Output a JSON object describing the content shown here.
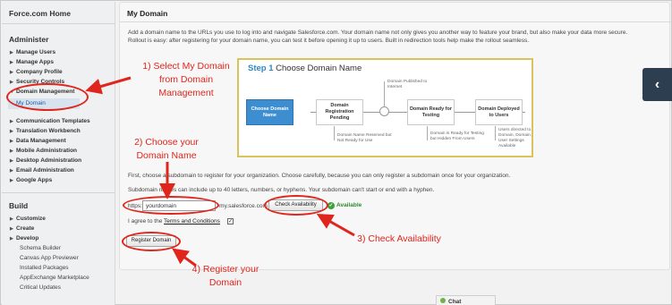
{
  "sidebar": {
    "home_title": "Force.com Home",
    "administer_header": "Administer",
    "administer_items": [
      {
        "label": "Manage Users"
      },
      {
        "label": "Manage Apps"
      },
      {
        "label": "Company Profile"
      },
      {
        "label": "Security Controls"
      },
      {
        "label": "Domain Management"
      }
    ],
    "active_sub": "My Domain",
    "more_items": [
      {
        "label": "Communication Templates"
      },
      {
        "label": "Translation Workbench"
      },
      {
        "label": "Data Management"
      },
      {
        "label": "Mobile Administration"
      },
      {
        "label": "Desktop Administration"
      },
      {
        "label": "Email Administration"
      },
      {
        "label": "Google Apps"
      }
    ],
    "build_header": "Build",
    "build_items": [
      {
        "label": "Customize"
      },
      {
        "label": "Create"
      },
      {
        "label": "Develop"
      }
    ],
    "build_subitems": [
      {
        "label": "Schema Builder"
      },
      {
        "label": "Canvas App Previewer"
      },
      {
        "label": "Installed Packages"
      },
      {
        "label": "AppExchange Marketplace"
      },
      {
        "label": "Critical Updates"
      }
    ]
  },
  "page": {
    "title": "My Domain",
    "intro_line1": "Add a domain name to the URLs you use to log into and navigate Salesforce.com. Your domain name not only gives you another way to feature your brand, but also make your data more secure.",
    "intro_line2": "Rollout is easy: after registering for your domain name, you can test it before opening it up to users. Built in redirection tools help make the rollout seamless.",
    "step_title": "Step 1",
    "step_name": "Choose Domain Name",
    "steps": [
      {
        "label": "Choose Domain Name"
      },
      {
        "label": "Domain Registration Pending"
      },
      {
        "label": "Domain Ready for Testing"
      },
      {
        "label": "Domain Deployed to Users"
      }
    ],
    "notes": {
      "published": "Domain Published to Internet",
      "reserved": "Domain Name Reserved but Not Ready for Use",
      "testing": "Domain is Ready for Testing but Hidden From Users",
      "deployed": "Users directed to Domain, Domain, User Settings Available"
    },
    "instruction1": "First, choose a subdomain to register for your organization. Choose carefully, because you can only register a subdomain once for your organization.",
    "instruction2": "Subdomain names can include up to 40 letters, numbers, or hyphens. Your subdomain can't start or end with a hyphen.",
    "url_prefix": "https://",
    "domain_value": "yourdomain",
    "url_suffix": "-my.salesforce.com",
    "check_button": "Check Availability",
    "available_text": "Available",
    "agree_prefix": "I agree to the",
    "terms_link": "Terms and Conditions",
    "register_button": "Register Domain"
  },
  "annotations": {
    "a1_line1": "1) Select My Domain",
    "a1_line2": "from Domain",
    "a1_line3": "Management",
    "a2_line1": "2) Choose your",
    "a2_line2": "Domain Name",
    "a3": "3) Check Availability",
    "a4_line1": "4) Register your",
    "a4_line2": "Domain",
    "color": "#e0251c"
  },
  "chat": {
    "label": "Chat"
  },
  "collapse_icon": "chevron-left-icon"
}
